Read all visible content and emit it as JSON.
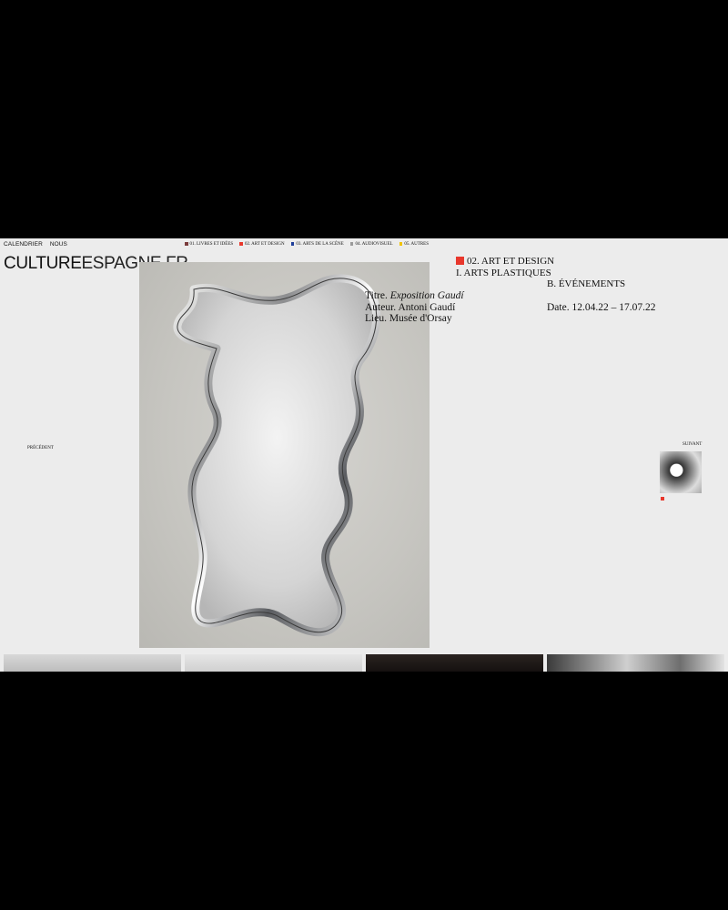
{
  "nav": {
    "calendar": "CALENDRIER",
    "about": "NOUS"
  },
  "categories": [
    {
      "label": "01. LIVRES ET IDÉES",
      "color": "#7a3b3b"
    },
    {
      "label": "02. ART ET DESIGN",
      "color": "#e8372c"
    },
    {
      "label": "03. ARTS DE LA SCÈNE",
      "color": "#1f3e9a"
    },
    {
      "label": "04. AUDIOVISUEL",
      "color": "#9a9a9a"
    },
    {
      "label": "05. AUTRES",
      "color": "#f2c400"
    }
  ],
  "logo": {
    "bold": "CULTURE",
    "thin": "ESPAGNE.FR"
  },
  "article": {
    "title_label": "Titre.",
    "title": "Exposition Gaudí",
    "author_label": "Auteur.",
    "author": "Antoni Gaudí",
    "place_label": "Lieu.",
    "place": "Musée d'Orsay"
  },
  "category_block": {
    "main": "02. ART ET DESIGN",
    "sub": "I. ARTS PLASTIQUES",
    "type": "B. ÉVÉNEMENTS"
  },
  "date": "Date. 12.04.22 – 17.07.22",
  "pager": {
    "prev": "PRÉCÉDENT",
    "next": "SUIVANT"
  },
  "accent_color": "#e8372c"
}
